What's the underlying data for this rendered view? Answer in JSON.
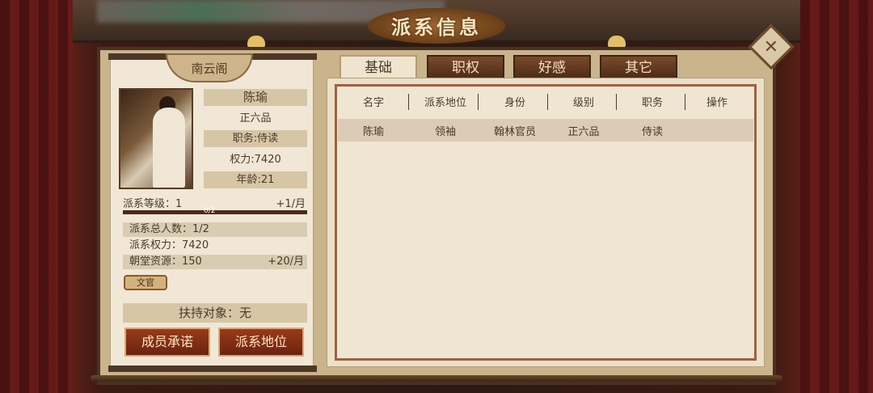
{
  "window": {
    "title": "派系信息",
    "close_icon": "close-icon"
  },
  "faction": {
    "name": "南云阁"
  },
  "member": {
    "name": "陈瑜",
    "rank": "正六品",
    "duty": "职务:侍读",
    "power": "权力:7420",
    "age": "年龄:21"
  },
  "level": {
    "label": "派系等级：1",
    "rate": "+1/月",
    "progress_text": "0/2",
    "progress_fraction": 0
  },
  "stats": {
    "members": "派系总人数：1/2",
    "faction_power": "派系权力：7420",
    "court_resources": "朝堂资源：150",
    "court_rate": "+20/月"
  },
  "tag": "文官",
  "support": "扶持对象：无",
  "buttons": {
    "promise": "成员承诺",
    "status": "派系地位"
  },
  "tabs": [
    "基础",
    "职权",
    "好感",
    "其它"
  ],
  "table": {
    "headers": [
      "名字",
      "派系地位",
      "身份",
      "级别",
      "职务",
      "操作"
    ],
    "rows": [
      [
        "陈瑜",
        "领袖",
        "翰林官员",
        "正六品",
        "侍读",
        ""
      ]
    ]
  },
  "colors": {
    "accent": "#a06040",
    "button": "#9a3a18"
  }
}
